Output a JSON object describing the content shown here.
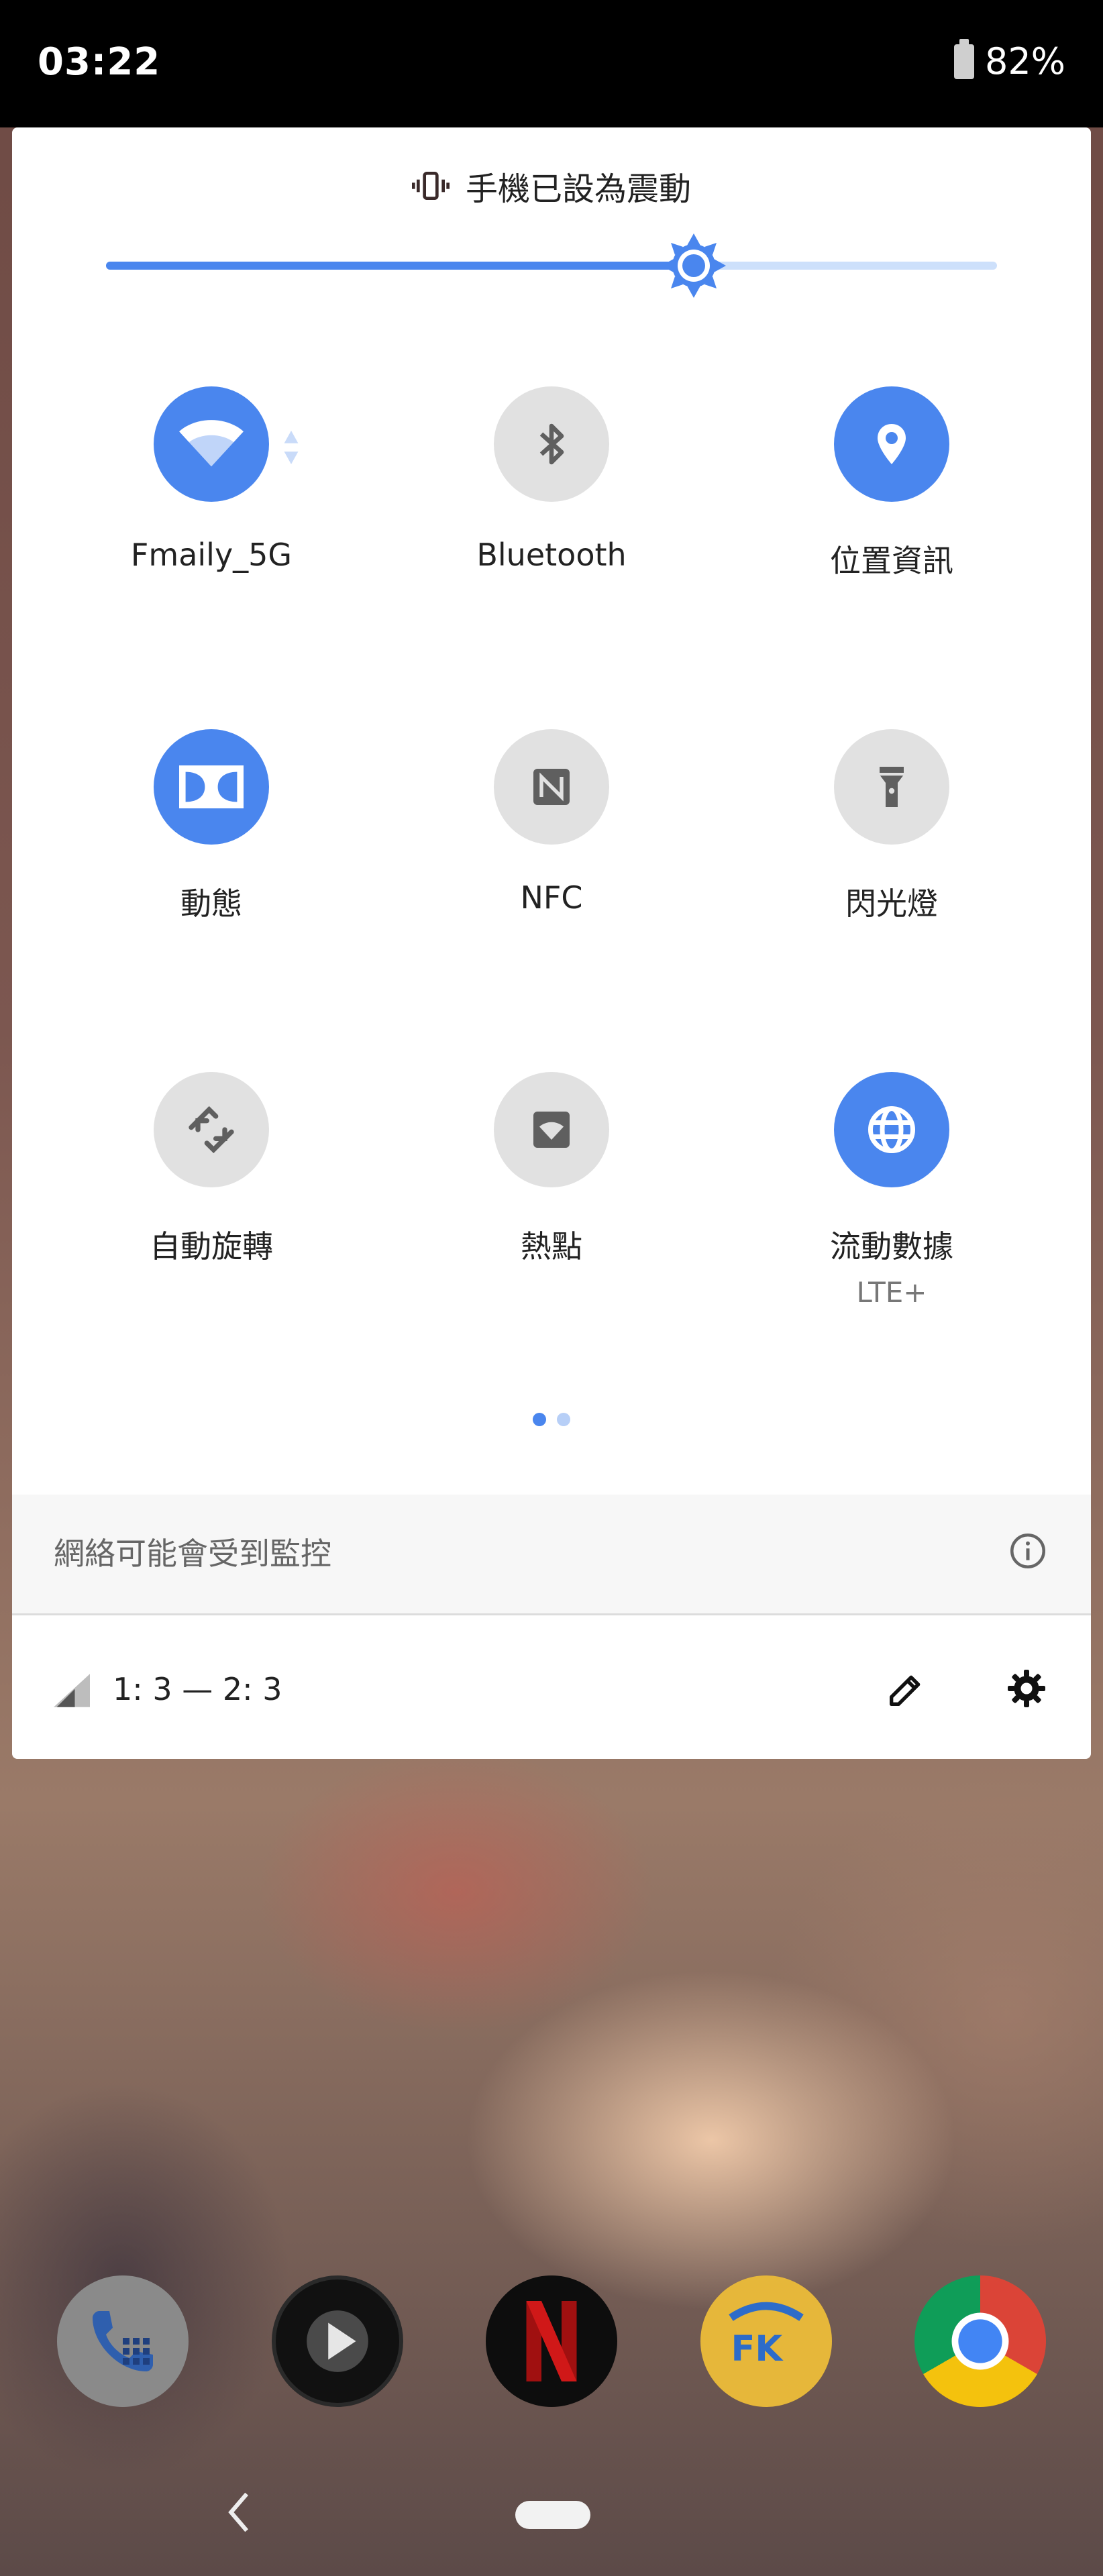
{
  "status_bar": {
    "time": "03:22",
    "battery_percent": "82%",
    "battery_icon": "battery-icon"
  },
  "ringer": {
    "icon": "vibrate-icon",
    "text": "手機已設為震動"
  },
  "brightness": {
    "level": 0.66,
    "icon": "brightness-icon",
    "color_fill": "#4a86ee",
    "color_track": "#cde0fb"
  },
  "tiles": [
    {
      "id": "wifi",
      "label": "Fmaily_5G",
      "icon": "wifi-icon",
      "state": "on"
    },
    {
      "id": "bluetooth",
      "label": "Bluetooth",
      "icon": "bluetooth-icon",
      "state": "off"
    },
    {
      "id": "location",
      "label": "位置資訊",
      "icon": "location-icon",
      "state": "on"
    },
    {
      "id": "dolby",
      "label": "動態",
      "icon": "dolby-icon",
      "state": "on"
    },
    {
      "id": "nfc",
      "label": "NFC",
      "icon": "nfc-icon",
      "state": "off"
    },
    {
      "id": "flashlight",
      "label": "閃光燈",
      "icon": "flashlight-icon",
      "state": "off"
    },
    {
      "id": "autorotate",
      "label": "自動旋轉",
      "icon": "auto-rotate-icon",
      "state": "off"
    },
    {
      "id": "hotspot",
      "label": "熱點",
      "icon": "hotspot-icon",
      "state": "off"
    },
    {
      "id": "mobile_data",
      "label": "流動數據",
      "sublabel": "LTE+",
      "icon": "mobile-data-icon",
      "state": "on"
    }
  ],
  "page_indicator": {
    "pages": 2,
    "current": 1
  },
  "monitor_notice": {
    "text": "網絡可能會受到監控",
    "icon": "info-icon"
  },
  "footer": {
    "carrier_text": "1: 3 — 2: 3",
    "signal_icon": "signal-icon",
    "edit_icon": "edit-icon",
    "settings_icon": "settings-icon"
  },
  "dock": [
    {
      "name": "phone",
      "icon": "phone-icon",
      "color": "#8f8f8f"
    },
    {
      "name": "play",
      "icon": "play-icon",
      "color": "#111111"
    },
    {
      "name": "netflix",
      "icon": "netflix-icon",
      "color": "#0d0d0d"
    },
    {
      "name": "fk",
      "icon": "fk-app-icon",
      "color": "#f2c23a"
    },
    {
      "name": "chrome",
      "icon": "chrome-icon",
      "color": "#db4437"
    }
  ],
  "colors": {
    "accent": "#4a86ee",
    "tile_off": "#e1e1e1",
    "panel_bg": "#ffffff"
  }
}
